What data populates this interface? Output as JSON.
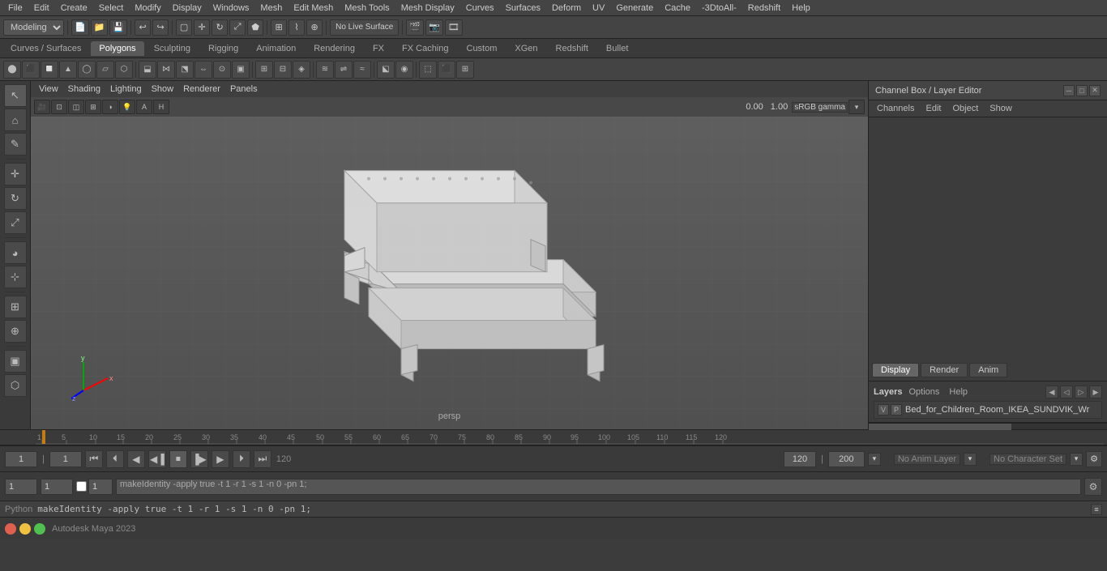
{
  "menu": {
    "items": [
      "File",
      "Edit",
      "Create",
      "Select",
      "Modify",
      "Display",
      "Windows",
      "Mesh",
      "Edit Mesh",
      "Mesh Tools",
      "Mesh Display",
      "Curves",
      "Surfaces",
      "Deform",
      "UV",
      "Generate",
      "Cache",
      "-3DtoAll-",
      "Redshift",
      "Help"
    ]
  },
  "toolbar1": {
    "workspace_label": "Modeling",
    "live_surface_label": "No Live Surface"
  },
  "tabs": {
    "items": [
      "Curves / Surfaces",
      "Polygons",
      "Sculpting",
      "Rigging",
      "Animation",
      "Rendering",
      "FX",
      "FX Caching",
      "Custom",
      "XGen",
      "Redshift",
      "Bullet"
    ],
    "active": "Polygons"
  },
  "viewport": {
    "menu_items": [
      "View",
      "Shading",
      "Lighting",
      "Show",
      "Renderer",
      "Panels"
    ],
    "perspective_label": "persp",
    "transform_value": "0.00",
    "transform_value2": "1.00",
    "color_space": "sRGB gamma"
  },
  "right_panel": {
    "title": "Channel Box / Layer Editor",
    "close_label": "✕",
    "minimize_label": "─",
    "expand_label": "□",
    "header_buttons": [
      "Channels",
      "Edit",
      "Object",
      "Show"
    ]
  },
  "display_tabs": {
    "items": [
      "Display",
      "Render",
      "Anim"
    ],
    "active": "Display"
  },
  "layers": {
    "title": "Layers",
    "menu_items": [
      "Options",
      "Help"
    ],
    "layer_row": {
      "v": "V",
      "p": "P",
      "name": "Bed_for_Children_Room_IKEA_SUNDVIK_Wr"
    },
    "scroll_position": 0
  },
  "playback": {
    "current_frame": "1",
    "range_start": "1",
    "range_end": "120",
    "range_end2": "120",
    "range_max": "200",
    "no_anim_layer": "No Anim Layer",
    "no_char_set": "No Character Set"
  },
  "status_bar": {
    "field1": "1",
    "field2": "1",
    "field3": "1",
    "command": "makeIdentity -apply true -t 1 -r 1 -s 1 -n 0 -pn 1;"
  },
  "python": {
    "label": "Python",
    "command": "makeIdentity -apply true -t 1 -r 1 -s 1 -n 0 -pn 1;"
  },
  "timeline": {
    "ticks": [
      "1",
      "5",
      "10",
      "15",
      "20",
      "25",
      "30",
      "35",
      "40",
      "45",
      "50",
      "55",
      "60",
      "65",
      "70",
      "75",
      "80",
      "85",
      "90",
      "95",
      "100",
      "105",
      "110",
      "115",
      "120"
    ]
  }
}
